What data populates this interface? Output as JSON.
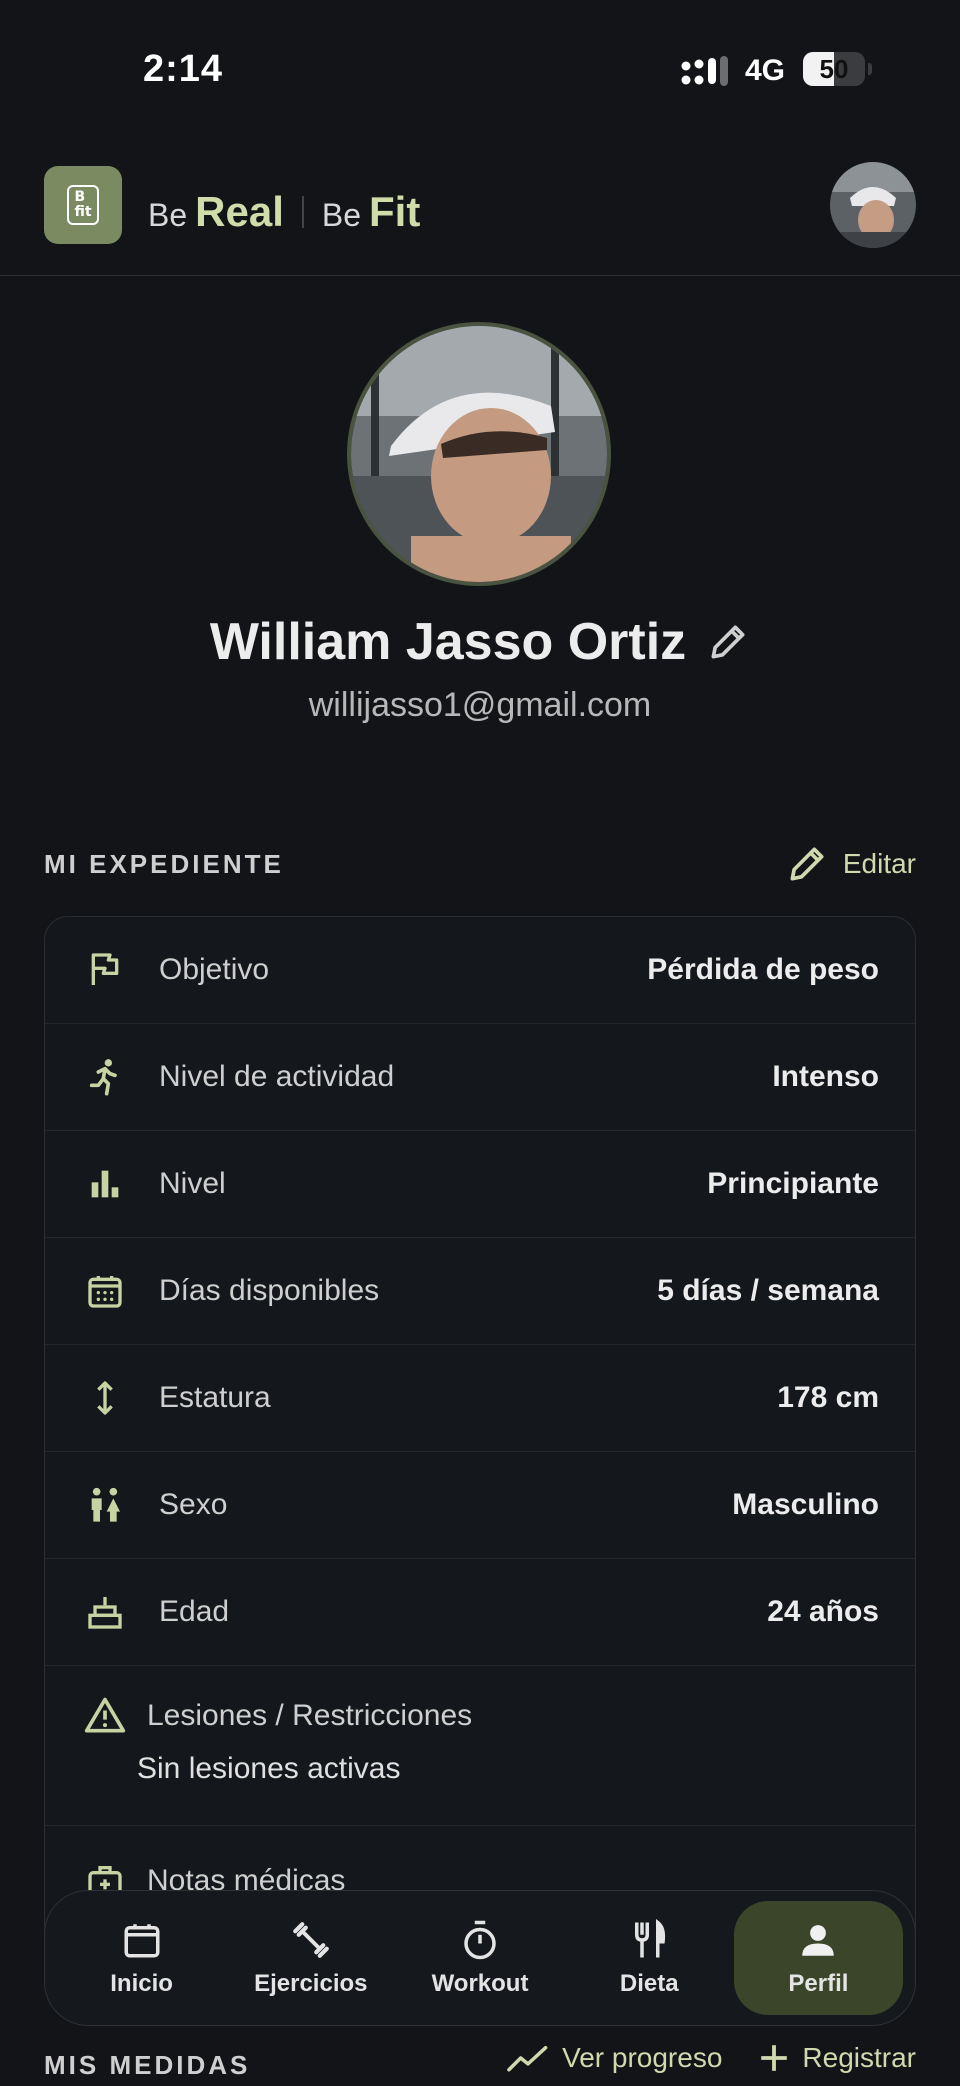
{
  "status": {
    "time": "2:14",
    "network": "4G",
    "battery": "50",
    "battery_level": 0.5
  },
  "header": {
    "brand_be_1": "Be",
    "brand_real": "Real",
    "brand_be_2": "Be",
    "brand_fit": "Fit"
  },
  "profile": {
    "name": "William Jasso Ortiz",
    "email": "willijasso1@gmail.com"
  },
  "expediente": {
    "title": "MI EXPEDIENTE",
    "edit_label": "Editar",
    "rows": [
      {
        "label": "Objetivo",
        "value": "Pérdida de peso",
        "icon": "flag-icon"
      },
      {
        "label": "Nivel de actividad",
        "value": "Intenso",
        "icon": "running-icon"
      },
      {
        "label": "Nivel",
        "value": "Principiante",
        "icon": "bar-chart-icon"
      },
      {
        "label": "Días disponibles",
        "value": "5 días / semana",
        "icon": "calendar-icon"
      },
      {
        "label": "Estatura",
        "value": "178 cm",
        "icon": "height-arrow-icon"
      },
      {
        "label": "Sexo",
        "value": "Masculino",
        "icon": "people-icon"
      },
      {
        "label": "Edad",
        "value": "24 años",
        "icon": "cake-icon"
      }
    ],
    "injuries": {
      "label": "Lesiones / Restricciones",
      "value": "Sin lesiones activas"
    },
    "notes": {
      "label": "Notas médicas"
    }
  },
  "tabs": [
    {
      "label": "Inicio",
      "icon": "calendar-icon"
    },
    {
      "label": "Ejercicios",
      "icon": "dumbbell-icon"
    },
    {
      "label": "Workout",
      "icon": "stopwatch-icon"
    },
    {
      "label": "Dieta",
      "icon": "fork-knife-icon"
    },
    {
      "label": "Perfil",
      "icon": "person-icon"
    }
  ],
  "medidas": {
    "title": "MIS MEDIDAS",
    "progress_label": "Ver progreso",
    "register_label": "Registrar"
  },
  "colors": {
    "accent": "#d0ddaa",
    "background": "#121418",
    "active_tab": "#3a4529"
  }
}
